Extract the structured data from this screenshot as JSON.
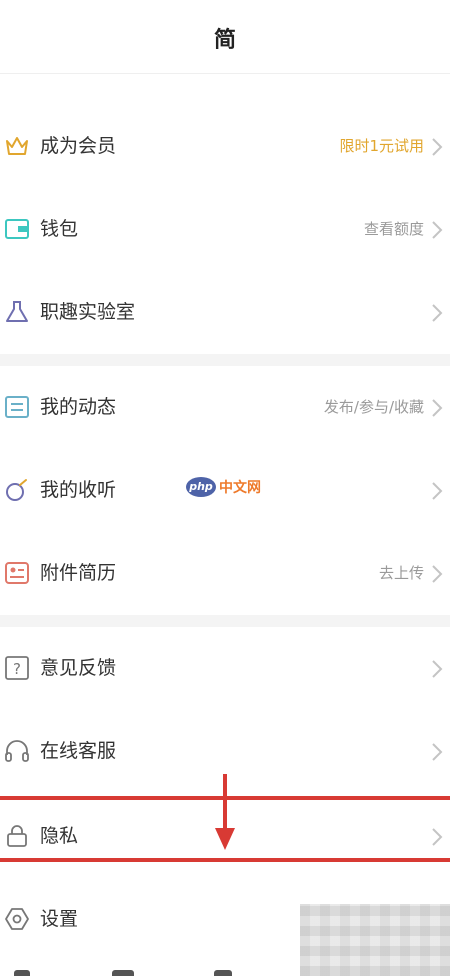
{
  "header": {
    "title": "简"
  },
  "menu": {
    "vip": {
      "label": "成为会员",
      "value": "限时1元试用"
    },
    "wallet": {
      "label": "钱包",
      "value": "查看额度"
    },
    "lab": {
      "label": "职趣实验室",
      "value": ""
    },
    "activity": {
      "label": "我的动态",
      "value": "发布/参与/收藏"
    },
    "listen": {
      "label": "我的收听",
      "value": ""
    },
    "resume": {
      "label": "附件简历",
      "value": "去上传"
    },
    "feedback": {
      "label": "意见反馈",
      "value": ""
    },
    "service": {
      "label": "在线客服",
      "value": ""
    },
    "privacy": {
      "label": "隐私",
      "value": ""
    },
    "settings": {
      "label": "设置",
      "value": ""
    }
  },
  "watermark": {
    "logo": "php",
    "text": "中文网"
  },
  "colors": {
    "gold": "#e1a62e",
    "teal": "#3cc7c0",
    "purple": "#6f6fb0",
    "resume_red": "#e0786a",
    "highlight_red": "#d83a34"
  },
  "icons": {
    "vip": "crown-icon",
    "wallet": "wallet-icon",
    "lab": "flask-icon",
    "activity": "message-icon",
    "listen": "music-icon",
    "resume": "resume-icon",
    "feedback": "question-icon",
    "service": "headphones-icon",
    "privacy": "lock-icon",
    "settings": "hexagon-settings-icon"
  }
}
